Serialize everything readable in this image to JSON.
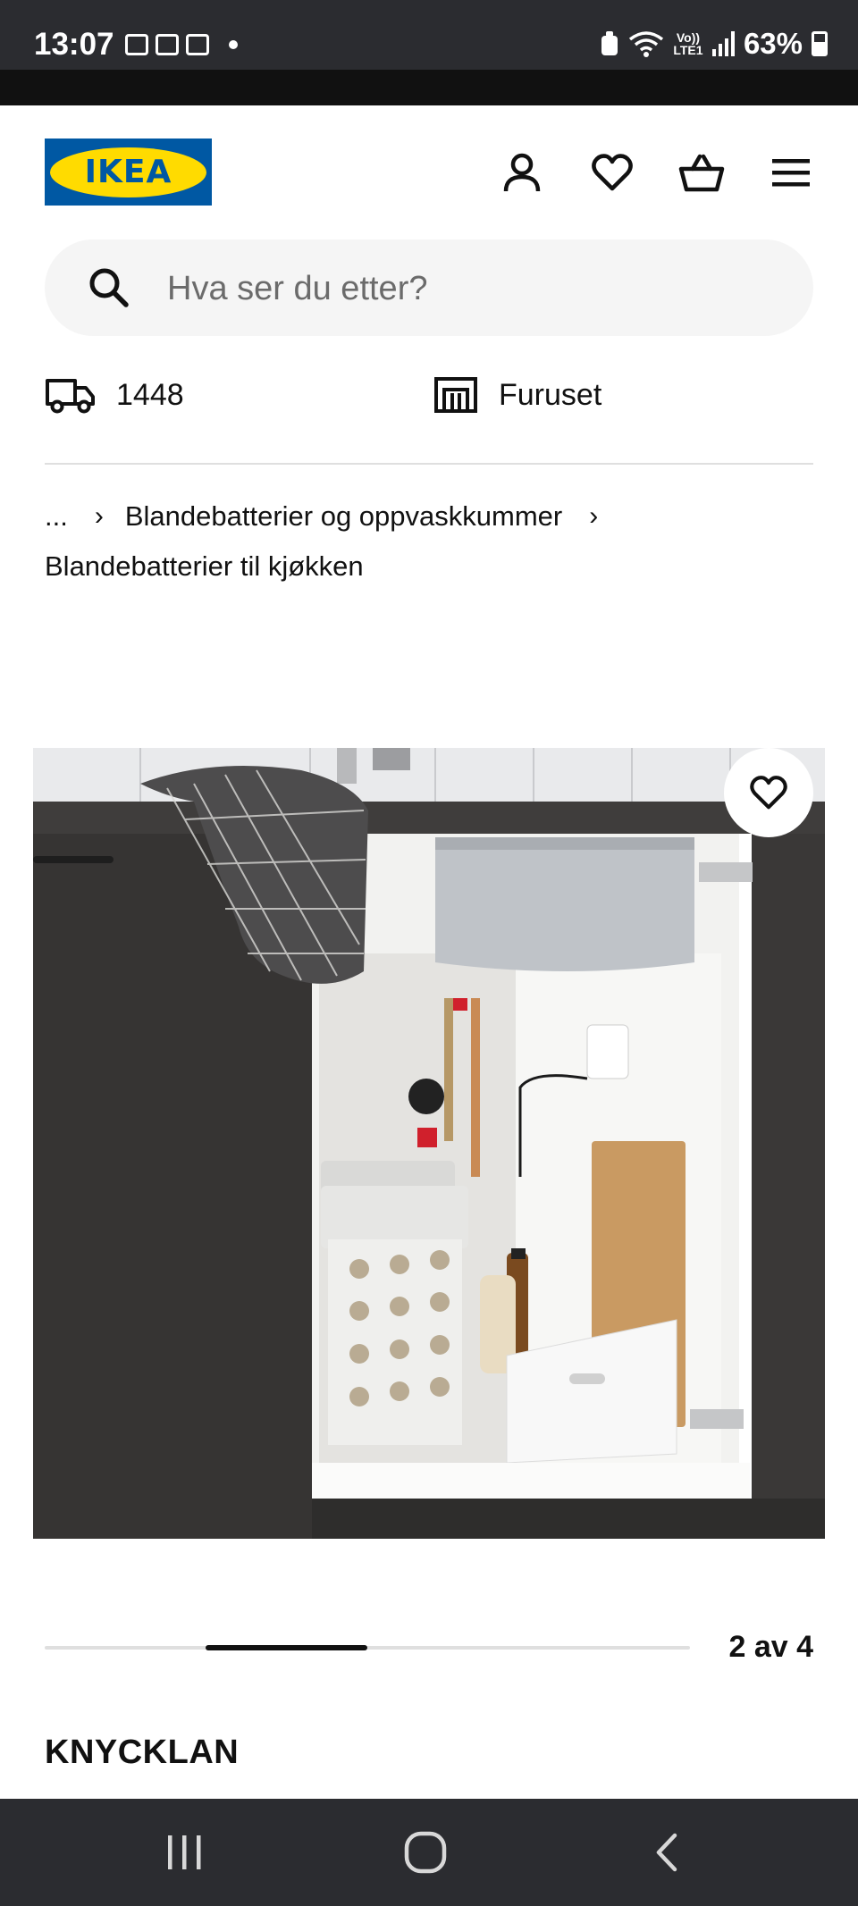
{
  "status_bar": {
    "time": "13:07",
    "volte": "Vo)) LTE1",
    "battery": "63%"
  },
  "header": {
    "logo_text": "IKEA",
    "brand_colors": {
      "blue": "#0058a3",
      "yellow": "#ffdb00"
    },
    "icons": [
      "user-icon",
      "heart-icon",
      "basket-icon",
      "menu-icon"
    ]
  },
  "search": {
    "placeholder": "Hva ser du etter?"
  },
  "location": {
    "postcode": "1448",
    "store": "Furuset"
  },
  "breadcrumb": {
    "ellipsis": "...",
    "level1": "Blandebatterier og oppvaskkummer",
    "level2": "Blandebatterier til kjøkken"
  },
  "gallery": {
    "counter": "2 av 4",
    "current": 2,
    "total": 4,
    "image_subject": "under-sink-cabinet-with-lighting"
  },
  "product": {
    "name": "KNYCKLAN"
  }
}
